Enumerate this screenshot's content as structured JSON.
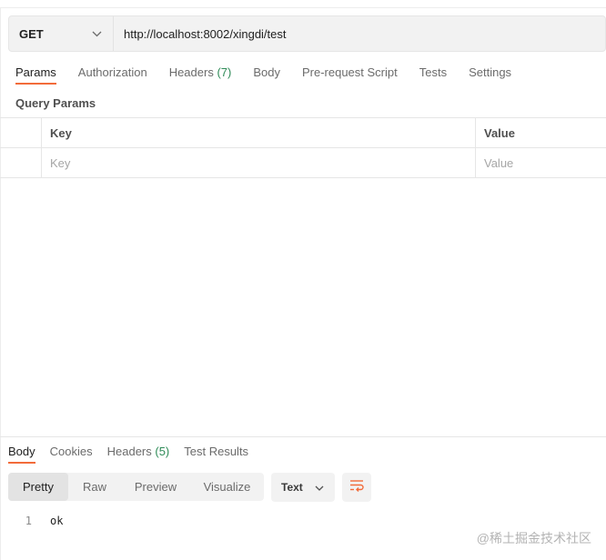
{
  "request": {
    "method": "GET",
    "url": "http://localhost:8002/xingdi/test"
  },
  "request_tabs": [
    {
      "label": "Params",
      "active": true
    },
    {
      "label": "Authorization"
    },
    {
      "label": "Headers ",
      "count": "(7)"
    },
    {
      "label": "Body"
    },
    {
      "label": "Pre-request Script"
    },
    {
      "label": "Tests"
    },
    {
      "label": "Settings"
    }
  ],
  "query_params": {
    "title": "Query Params",
    "header": {
      "key": "Key",
      "value": "Value"
    },
    "placeholder": {
      "key": "Key",
      "value": "Value"
    }
  },
  "response_tabs": [
    {
      "label": "Body",
      "active": true
    },
    {
      "label": "Cookies"
    },
    {
      "label": "Headers ",
      "count": "(5)"
    },
    {
      "label": "Test Results"
    }
  ],
  "view_modes": [
    "Pretty",
    "Raw",
    "Preview",
    "Visualize"
  ],
  "format": "Text",
  "response_body": {
    "line_number": "1",
    "text": "ok"
  },
  "watermark": "@稀土掘金技术社区",
  "colors": {
    "accent": "#f26b3a",
    "count": "#2e8b57"
  },
  "icons": {
    "method_dropdown": "chevron-down-icon",
    "format_dropdown": "chevron-down-icon",
    "wrap": "wrap-lines-icon"
  }
}
